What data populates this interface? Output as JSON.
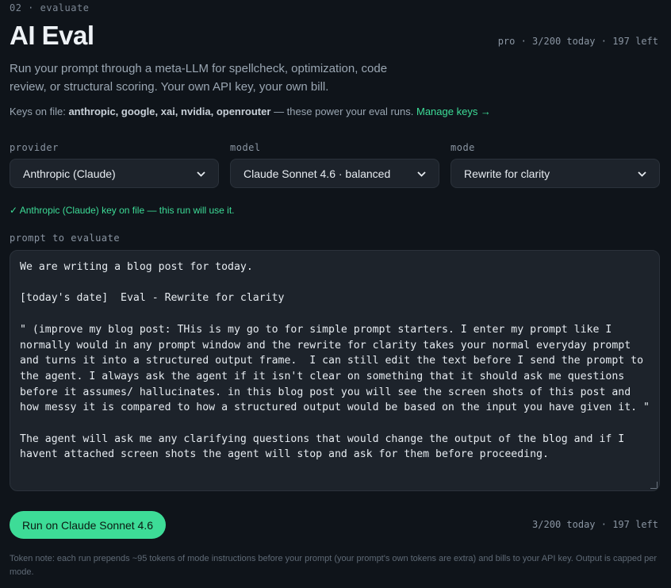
{
  "header": {
    "eyebrow": "02 · evaluate",
    "title": "AI Eval",
    "usage": "pro · 3/200 today · 197 left"
  },
  "description": "Run your prompt through a meta-LLM for spellcheck, optimization, code review, or structural scoring. Your own API key, your own bill.",
  "keys": {
    "prefix": "Keys on file:",
    "list": "anthropic, google, xai, nvidia, openrouter",
    "suffix": "— these power your eval runs.",
    "manage_link": "Manage keys →"
  },
  "fields": {
    "provider": {
      "label": "provider",
      "value": "Anthropic (Claude)"
    },
    "model": {
      "label": "model",
      "value": "Claude Sonnet 4.6 · balanced"
    },
    "mode": {
      "label": "mode",
      "value": "Rewrite for clarity"
    }
  },
  "key_status": "✓ Anthropic (Claude) key on file — this run will use it.",
  "prompt": {
    "label": "prompt to evaluate",
    "value": "We are writing a blog post for today.\n\n[today's date]  Eval - Rewrite for clarity\n\n\" (improve my blog post: THis is my go to for simple prompt starters. I enter my prompt like I normally would in any prompt window and the rewrite for clarity takes your normal everyday prompt and turns it into a structured output frame.  I can still edit the text before I send the prompt to the agent. I always ask the agent if it isn't clear on something that it should ask me questions before it assumes/ hallucinates. in this blog post you will see the screen shots of this post and how messy it is compared to how a structured output would be based on the input you have given it. \"\n\nThe agent will ask me any clarifying questions that would change the output of the blog and if I havent attached screen shots the agent will stop and ask for them before proceeding."
  },
  "run_button": "Run on Claude Sonnet 4.6",
  "usage_bottom": "3/200 today · 197 left",
  "token_note": "Token note: each run prepends ~95 tokens of mode instructions before your prompt (your prompt's own tokens are extra) and bills to your API key. Output is capped per mode.",
  "colors": {
    "background": "#0f141a",
    "accent": "#3ddc97",
    "field_bg": "#1d232b"
  }
}
